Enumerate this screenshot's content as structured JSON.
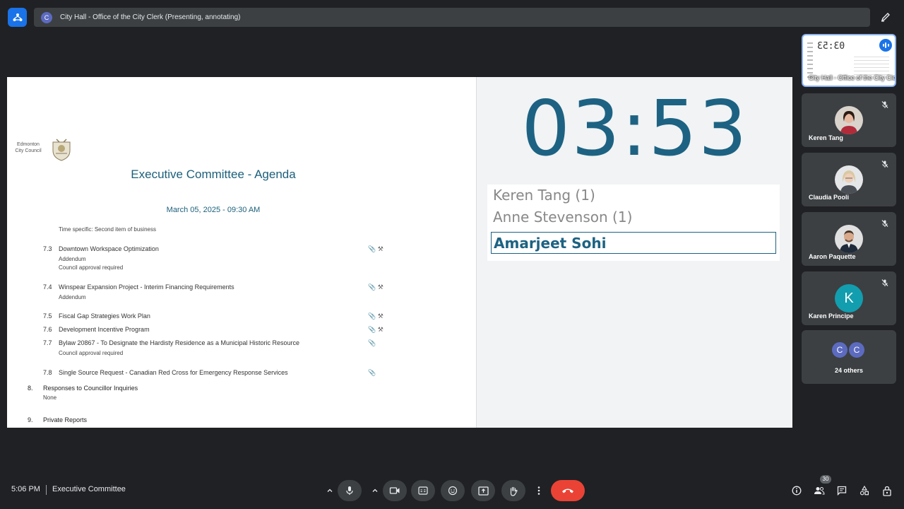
{
  "meeting": {
    "presenter_initial": "C",
    "window_title": "City Hall - Office of the City Clerk (Presenting, annotating)",
    "time": "5:06 PM",
    "name": "Executive Committee"
  },
  "document": {
    "logo_text": "Edmonton City Council",
    "title": "Executive Committee - Agenda",
    "date": "March 05, 2025 - 09:30 AM",
    "partial_item_sub": "Time specific: Second item of business",
    "items": [
      {
        "num": "7.3",
        "title": "Downtown Workspace Optimization",
        "subs": [
          "Addendum",
          "Council approval required"
        ],
        "icons": "📎 ⚒"
      },
      {
        "num": "7.4",
        "title": "Winspear Expansion Project - Interim Financing Requirements",
        "subs": [
          "Addendum"
        ],
        "icons": "📎 ⚒"
      },
      {
        "num": "7.5",
        "title": "Fiscal Gap Strategies Work Plan",
        "subs": [],
        "icons": "📎 ⚒"
      },
      {
        "num": "7.6",
        "title": "Development Incentive Program",
        "subs": [],
        "icons": "📎 ⚒"
      },
      {
        "num": "7.7",
        "title": "Bylaw 20867 - To Designate the Hardisty Residence as a Municipal Historic Resource",
        "subs": [
          "Council approval required"
        ],
        "icons": "📎"
      },
      {
        "num": "7.8",
        "title": "Single Source Request - Canadian Red Cross for Emergency Response Services",
        "subs": [],
        "icons": "📎"
      }
    ],
    "sections": [
      {
        "num": "8.",
        "title": "Responses to Councillor Inquiries",
        "sub": "None"
      },
      {
        "num": "9.",
        "title": "Private Reports",
        "sub": ""
      }
    ]
  },
  "timer": {
    "value": "03:53",
    "queue": [
      "Keren Tang (1)",
      "Anne Stevenson (1)"
    ],
    "current_speaker": "Amarjeet Sohi"
  },
  "participants": {
    "self_tile_caption": "City Hall - Office of the City Clerk",
    "self_tile_timer": "03:53",
    "tiles": [
      {
        "name": "Keren Tang",
        "avatar": "photo"
      },
      {
        "name": "Claudia Pooli",
        "avatar": "photo"
      },
      {
        "name": "Aaron Paquette",
        "avatar": "photo"
      },
      {
        "name": "Karen Principe",
        "avatar": "K"
      }
    ],
    "others_initials": [
      "C",
      "C"
    ],
    "others_label": "24 others",
    "count": "30"
  },
  "colors": {
    "accent": "#1d6282",
    "end_call": "#ea4335",
    "brand": "#1a73e8"
  }
}
